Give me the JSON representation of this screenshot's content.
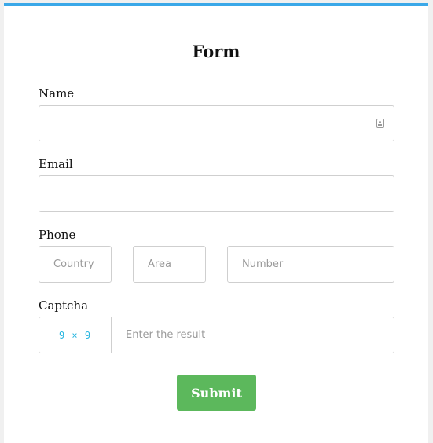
{
  "form": {
    "title": "Form",
    "name": {
      "label": "Name",
      "value": "",
      "icon": "contact-card-icon"
    },
    "email": {
      "label": "Email",
      "value": ""
    },
    "phone": {
      "label": "Phone",
      "country_placeholder": "Country",
      "area_placeholder": "Area",
      "number_placeholder": "Number"
    },
    "captcha": {
      "label": "Captcha",
      "challenge": "9 × 9",
      "placeholder": "Enter the result"
    },
    "submit_label": "Submit"
  },
  "colors": {
    "accent_top_border": "#3aa8e8",
    "submit_button": "#5cb85c",
    "captcha_text": "#28b6e0"
  }
}
